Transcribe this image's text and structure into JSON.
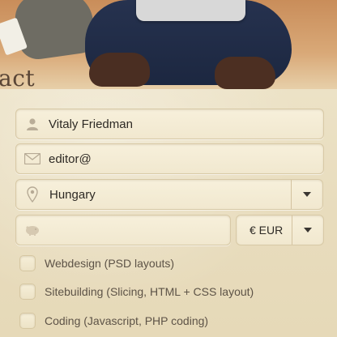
{
  "header": {
    "title": "act"
  },
  "form": {
    "name": {
      "value": "Vitaly Friedman",
      "icon": "user-icon"
    },
    "email": {
      "value": "editor@",
      "icon": "envelope-icon"
    },
    "country": {
      "value": "Hungary",
      "icon": "map-pin-icon"
    },
    "budget": {
      "value": "",
      "icon": "piggy-bank-icon"
    },
    "currency": {
      "value": "€ EUR"
    },
    "services": [
      {
        "label": "Webdesign (PSD layouts)",
        "checked": false
      },
      {
        "label": "Sitebuilding (Slicing, HTML + CSS layout)",
        "checked": false
      },
      {
        "label": "Coding (Javascript, PHP coding)",
        "checked": false
      }
    ]
  }
}
